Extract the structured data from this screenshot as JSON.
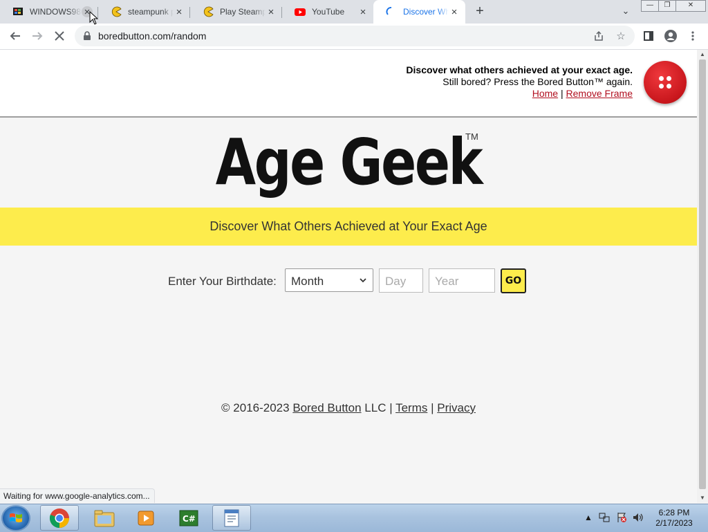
{
  "browser": {
    "tabs": [
      {
        "title": "WINDOWS98",
        "active": false
      },
      {
        "title": "steampunk p",
        "active": false
      },
      {
        "title": "Play Steamp",
        "active": false
      },
      {
        "title": "YouTube",
        "active": false
      },
      {
        "title": "Discover Wh",
        "active": true
      }
    ],
    "url": "boredbutton.com/random",
    "status_text": "Waiting for www.google-analytics.com..."
  },
  "frame": {
    "headline": "Discover what others achieved at your exact age.",
    "subline": "Still bored? Press the Bored Button™ again.",
    "home_link": "Home",
    "separator": "|",
    "remove_frame_link": "Remove Frame"
  },
  "page": {
    "logo": "Age Geek",
    "trademark": "TM",
    "tagline": "Discover What Others Achieved at Your Exact Age",
    "birthdate_label": "Enter Your Birthdate:",
    "month_value": "Month",
    "day_placeholder": "Day",
    "year_placeholder": "Year",
    "go_label": "GO",
    "footer": {
      "copyright": "© 2016-2023",
      "bored_button_link": "Bored Button",
      "llc": "LLC",
      "sep": "|",
      "terms_link": "Terms",
      "privacy_link": "Privacy"
    }
  },
  "taskbar": {
    "time": "6:28 PM",
    "date": "2/17/2023"
  },
  "colors": {
    "banner_yellow": "#fdec4c",
    "link_red": "#b10e1e",
    "button_red": "#d01c22",
    "active_tab_text": "#1a73e8"
  }
}
